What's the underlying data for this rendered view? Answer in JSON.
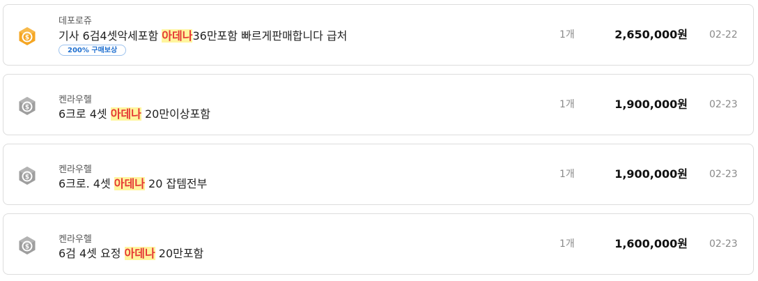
{
  "listings": [
    {
      "server": "데포로쥬",
      "title_pre": "기사 6검4셋악세포함 ",
      "title_highlight": "아데나",
      "title_post": "36만포함 빠르게판매합니다 급처",
      "badge": "200% 구매보상",
      "quantity": "1개",
      "price": "2,650,000원",
      "date": "02-22",
      "icon": "gold-hexagon-coin-icon",
      "icon_color": "#f5a623"
    },
    {
      "server": "켄라우헬",
      "title_pre": "6크로 4셋 ",
      "title_highlight": "아데나",
      "title_post": " 20만이상포함",
      "quantity": "1개",
      "price": "1,900,000원",
      "date": "02-23",
      "icon": "gray-hexagon-coin-icon",
      "icon_color": "#9e9e9e"
    },
    {
      "server": "켄라우헬",
      "title_pre": "6크로. 4셋 ",
      "title_highlight": "아데나",
      "title_post": " 20 잡템전부",
      "quantity": "1개",
      "price": "1,900,000원",
      "date": "02-23",
      "icon": "gray-hexagon-coin-icon",
      "icon_color": "#9e9e9e"
    },
    {
      "server": "켄라우헬",
      "title_pre": "6검 4셋 요정 ",
      "title_highlight": "아데나",
      "title_post": " 20만포함",
      "quantity": "1개",
      "price": "1,600,000원",
      "date": "02-23",
      "icon": "gray-hexagon-coin-icon",
      "icon_color": "#9e9e9e"
    }
  ],
  "colors": {
    "highlight_bg": "#fff59d",
    "highlight_text": "#e53935",
    "badge_text": "#1e6fd0",
    "border": "#dcdcdc"
  }
}
